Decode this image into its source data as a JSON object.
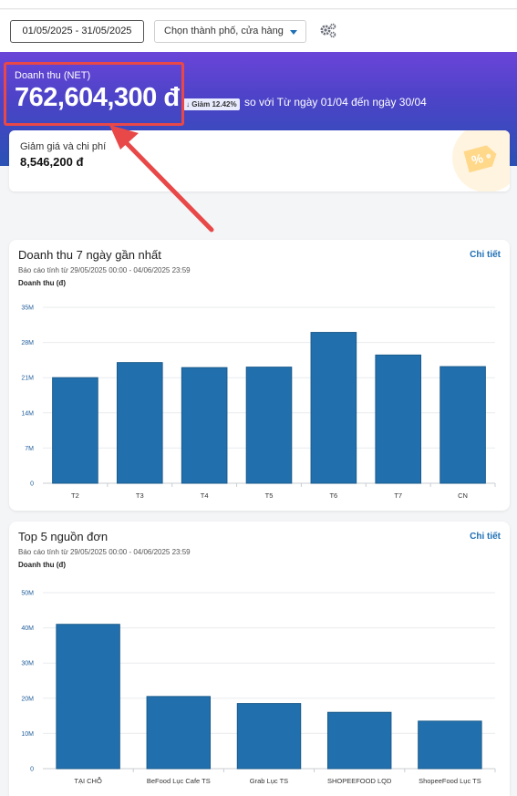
{
  "filters": {
    "date_range": "01/05/2025 - 31/05/2025",
    "city_placeholder": "Chọn thành phố, cửa hàng"
  },
  "icons": {
    "settings": "gear-icon",
    "dropdown": "chevron-down-icon",
    "discount_tag": "percent-tag-icon"
  },
  "colors": {
    "accent": "#1f6fb5",
    "bar": "#2170ad",
    "hero_top": "#6a45d8",
    "hero_bottom": "#2a51b5",
    "highlight": "#e84848"
  },
  "revenue": {
    "title": "Doanh thu (NET)",
    "value": "762,604,300 đ",
    "change_badge": "↓ Giảm 12.42%",
    "comparison": "so với Từ ngày 01/04 đến ngày 30/04"
  },
  "discount": {
    "label": "Giảm giá và chi phí",
    "value": "8,546,200 đ"
  },
  "weekly": {
    "title": "Doanh thu 7 ngày gần nhất",
    "link": "Chi tiết",
    "subtitle": "Báo cáo tính từ 29/05/2025 00:00 - 04/06/2025 23:59",
    "ylabel": "Doanh thu (đ)"
  },
  "sources": {
    "title": "Top 5 nguồn đơn",
    "link": "Chi tiết",
    "subtitle": "Báo cáo tính từ 29/05/2025 00:00 - 04/06/2025 23:59",
    "ylabel": "Doanh thu (đ)"
  },
  "chart_data": [
    {
      "type": "bar",
      "title": "Doanh thu 7 ngày gần nhất",
      "ylabel": "Doanh thu (đ)",
      "categories": [
        "T2",
        "T3",
        "T4",
        "T5",
        "T6",
        "T7",
        "CN"
      ],
      "values": [
        21000000,
        24000000,
        23000000,
        23100000,
        30000000,
        25500000,
        23200000
      ],
      "ylim": [
        0,
        35000000
      ],
      "yticks": [
        "0",
        "7M",
        "14M",
        "21M",
        "28M",
        "35M"
      ],
      "grid": true
    },
    {
      "type": "bar",
      "title": "Top 5 nguồn đơn",
      "ylabel": "Doanh thu (đ)",
      "categories": [
        "TẠI CHỖ",
        "BeFood Lục Cafe TS",
        "Grab Lục TS",
        "SHOPEEFOOD LQD",
        "ShopeeFood Lục TS"
      ],
      "values": [
        41000000,
        20500000,
        18500000,
        16000000,
        13500000
      ],
      "ylim": [
        0,
        50000000
      ],
      "yticks": [
        "0",
        "10M",
        "20M",
        "30M",
        "40M",
        "50M"
      ],
      "grid": true
    }
  ]
}
